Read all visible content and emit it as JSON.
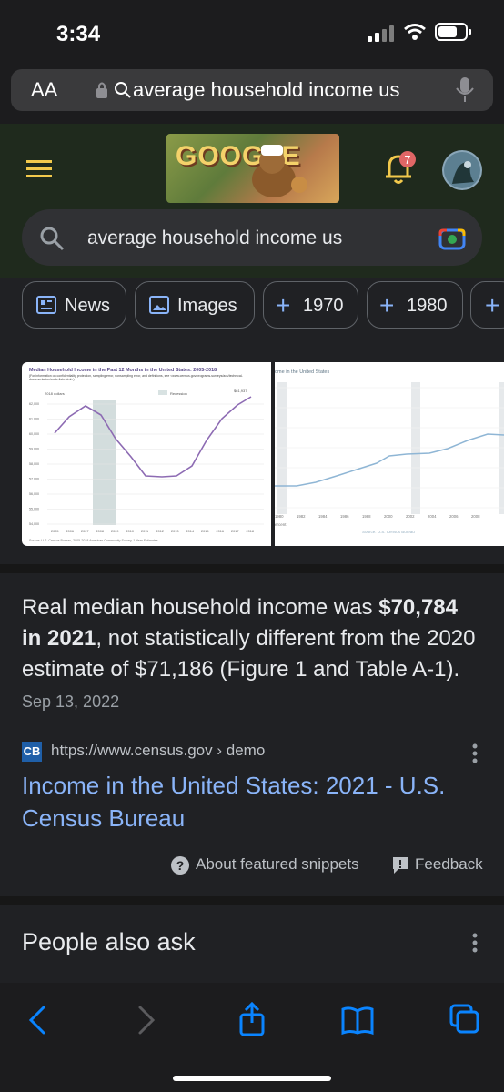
{
  "status": {
    "time": "3:34"
  },
  "browser": {
    "aa": "AA",
    "url_text": "average household income us"
  },
  "google": {
    "doodle_text": "GOOGLE",
    "notification_count": "7",
    "search_text": "average household income us"
  },
  "filters": [
    {
      "label": "News"
    },
    {
      "label": "Images"
    },
    {
      "label": "1970"
    },
    {
      "label": "1980"
    }
  ],
  "image1": {
    "title": "Median Household Income in the Past 12 Months in the United States: 2005-2018",
    "note": "(For information on confidentiality protection, sampling error, nonsampling error, and definitions, see <www.census.gov/programs-surveys/acs/technical-documentation/code-lists.html>)",
    "legend": "2018 dollars",
    "recession": "Recession",
    "peak_label": "$61,937",
    "source": "Source: U.S. Census Bureau, 2005-2018 American Community Survey, 1-Year Estimates",
    "yticks": [
      "62,000",
      "61,000",
      "60,000",
      "59,000",
      "58,000",
      "57,000",
      "56,000",
      "55,000",
      "54,000"
    ],
    "xticks": [
      "2005",
      "2006",
      "2007",
      "2008",
      "2009",
      "2010",
      "2011",
      "2012",
      "2013",
      "2014",
      "2015",
      "2016",
      "2017",
      "2018"
    ]
  },
  "image2": {
    "title": "ome in the United States",
    "xticks": [
      "1980",
      "1982",
      "1984",
      "1986",
      "1988",
      "2000",
      "2002",
      "2004",
      "2006",
      "2008"
    ],
    "ylabel": "ercent",
    "source": "Source: U.S. Census Bureau"
  },
  "snippet": {
    "text_before": "Real median household income was ",
    "bold": "$70,784 in 2021",
    "text_after": ", not statistically different from the 2020 estimate of $71,186 (Figure 1 and Table A-1).",
    "date": "Sep 13, 2022"
  },
  "result": {
    "favicon": "CB",
    "url": "https://www.census.gov › demo",
    "title": "Income in the United States: 2021 - U.S. Census Bureau"
  },
  "snippet_footer": {
    "about": "About featured snippets",
    "feedback": "Feedback"
  },
  "people_also_ask": {
    "title": "People also ask"
  },
  "colors": {
    "background": "#202124",
    "link": "#8ab4f8",
    "safari_blue": "#0a84ff",
    "chart_purple": "#8d6bb3"
  }
}
